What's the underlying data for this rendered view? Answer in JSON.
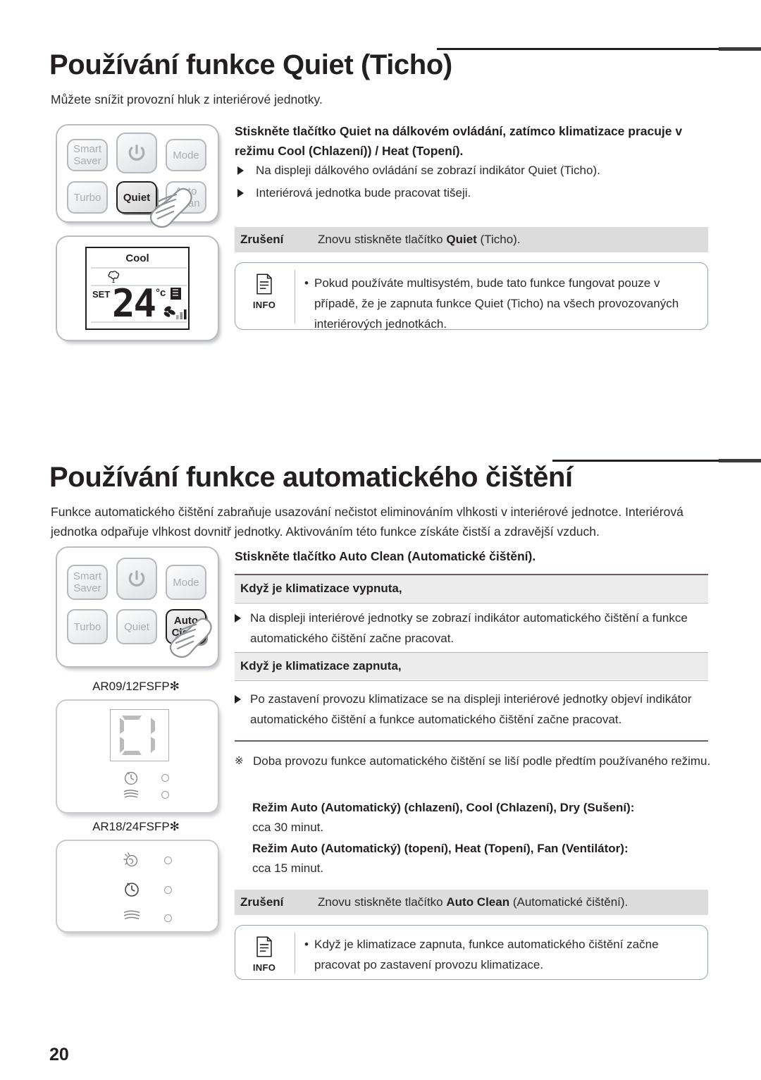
{
  "page": {
    "number": "20"
  },
  "sections": [
    {
      "id": "quiet",
      "title": "Používání funkce Quiet (Ticho)",
      "intro": "Můžete snížit provozní hluk z interiérové jednotky.",
      "lead_bold": "Stiskněte tlačítko Quiet na dálkovém ovládání, zatímco klimatizace pracuje v režimu Cool (Chlazení)) / Heat (Topení).",
      "lead_parts": {
        "p1": "Stiskněte tlačítko ",
        "p2": "Quiet",
        "p3": " na dálkovém ovládání, zatímco klimatizace pracuje v režimu Cool (Chlazení)) / Heat (Topení)."
      },
      "bullets": [
        "Na displeji dálkového ovládání se zobrazí indikátor Quiet (Ticho).",
        "Interiérová jednotka bude pracovat tišeji."
      ],
      "cancel": {
        "label": "Zrušení",
        "text_before": "Znovu stiskněte tlačítko ",
        "text_bold": "Quiet",
        "text_after": " (Ticho)."
      },
      "info": {
        "icon_label": "INFO",
        "text": "Pokud používáte multisystém, bude tato funkce fungovat pouze v případě, že je zapnuta funkce Quiet (Ticho) na všech provozovaných interiérových jednotkách."
      }
    },
    {
      "id": "autoclean",
      "title": "Používání funkce automatického čištění",
      "intro": "Funkce automatického čištění zabraňuje usazování nečistot eliminováním vlhkosti v interiérové jednotce. Interiérová jednotka odpařuje vlhkost dovnitř jednotky. Aktivováním této funkce získáte čistší a zdravější vzduch.",
      "lead_parts": {
        "p1": "Stiskněte tlačítko ",
        "p2": "Auto Clean",
        "p3": " (Automatické čištění)."
      },
      "subhead_off": "Když je klimatizace vypnuta,",
      "bullet_off": "Na displeji interiérové jednotky se zobrazí indikátor automatického čištění a funkce automatického čištění začne pracovat.",
      "subhead_on": "Když je klimatizace zapnuta,",
      "bullet_on": "Po zastavení provozu klimatizace se na displeji interiérové jednotky objeví indikátor automatického čištění a funkce automatického čištění začne pracovat.",
      "note": {
        "mark": "※",
        "text": "Doba provozu funkce automatického čištění se liší podle předtím používaného režimu."
      },
      "modes": [
        {
          "name": "Režim Auto (Automatický) (chlazení), Cool (Chlazení), Dry (Sušení):",
          "duration": "cca 30 minut."
        },
        {
          "name": "Režim Auto (Automatický) (topení), Heat (Topení), Fan (Ventilátor):",
          "duration": "cca 15 minut."
        }
      ],
      "cancel": {
        "label": "Zrušení",
        "text_before": "Znovu stiskněte tlačítko ",
        "text_bold": "Auto Clean",
        "text_after": " (Automatické čištění)."
      },
      "info": {
        "icon_label": "INFO",
        "text": "Když je klimatizace zapnuta, funkce automatického čištění začne pracovat po zastavení provozu klimatizace."
      }
    }
  ],
  "remote_quiet": {
    "buttons": [
      {
        "name": "smart-saver",
        "label": "Smart\nSaver"
      },
      {
        "name": "power",
        "label": ""
      },
      {
        "name": "mode",
        "label": "Mode"
      },
      {
        "name": "turbo",
        "label": "Turbo"
      },
      {
        "name": "quiet",
        "label": "Quiet"
      },
      {
        "name": "auto-clean",
        "label": "Auto\nClean"
      }
    ],
    "highlighted": "Quiet"
  },
  "remote_autoclean": {
    "buttons": [
      {
        "name": "smart-saver",
        "label": "Smart\nSaver"
      },
      {
        "name": "power",
        "label": ""
      },
      {
        "name": "mode",
        "label": "Mode"
      },
      {
        "name": "turbo",
        "label": "Turbo"
      },
      {
        "name": "quiet",
        "label": "Quiet"
      },
      {
        "name": "auto-clean",
        "label": "Auto\nClean"
      }
    ],
    "highlighted": "Auto Clean"
  },
  "lcd": {
    "mode": "Cool",
    "set_label": "SET",
    "temperature": "24",
    "degree": "°c"
  },
  "unit_panels": [
    {
      "model": "AR09/12FSFP✻",
      "segment_display": "C1",
      "indicator_count": 2
    },
    {
      "model": "AR18/24FSFP✻",
      "segment_display": "",
      "indicator_count": 3
    }
  ],
  "colors": {
    "text": "#231f20",
    "grey_bar": "#dcdcdc",
    "sub_bar": "#ececec",
    "rule": "#231f20",
    "info_border": "#9aa3b2"
  }
}
